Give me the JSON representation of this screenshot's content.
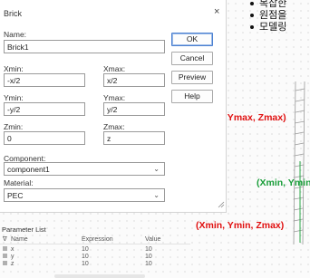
{
  "dialog": {
    "title": "Brick",
    "close_glyph": "×",
    "name_label": "Name:",
    "name_value": "Brick1",
    "xmin_label": "Xmin:",
    "xmin_value": "-x/2",
    "xmax_label": "Xmax:",
    "xmax_value": "x/2",
    "ymin_label": "Ymin:",
    "ymin_value": "-y/2",
    "ymax_label": "Ymax:",
    "ymax_value": "y/2",
    "zmin_label": "Zmin:",
    "zmin_value": "0",
    "zmax_label": "Zmax:",
    "zmax_value": "z",
    "component_label": "Component:",
    "component_value": "component1",
    "material_label": "Material:",
    "material_value": "PEC",
    "buttons": {
      "ok": "OK",
      "cancel": "Cancel",
      "preview": "Preview",
      "help": "Help"
    }
  },
  "slide": {
    "bullets": [
      "복잡한",
      "원점을",
      "모델링"
    ],
    "annotations": {
      "top_right": "(Xmin, Ymax, Zmax)",
      "middle": "(Xmin, Ymin",
      "bottom": "(Xmin, Ymin, Zmax)"
    },
    "colors": {
      "red": "#e01010",
      "green": "#1a9e3a"
    }
  },
  "parameter_list": {
    "title": "Parameter List",
    "columns": [
      "Name",
      "Expression",
      "Value"
    ],
    "rows": [
      {
        "name": "x",
        "expression": "10",
        "value": "10"
      },
      {
        "name": "y",
        "expression": "10",
        "value": "10"
      },
      {
        "name": "z",
        "expression": "10",
        "value": "10"
      }
    ]
  }
}
